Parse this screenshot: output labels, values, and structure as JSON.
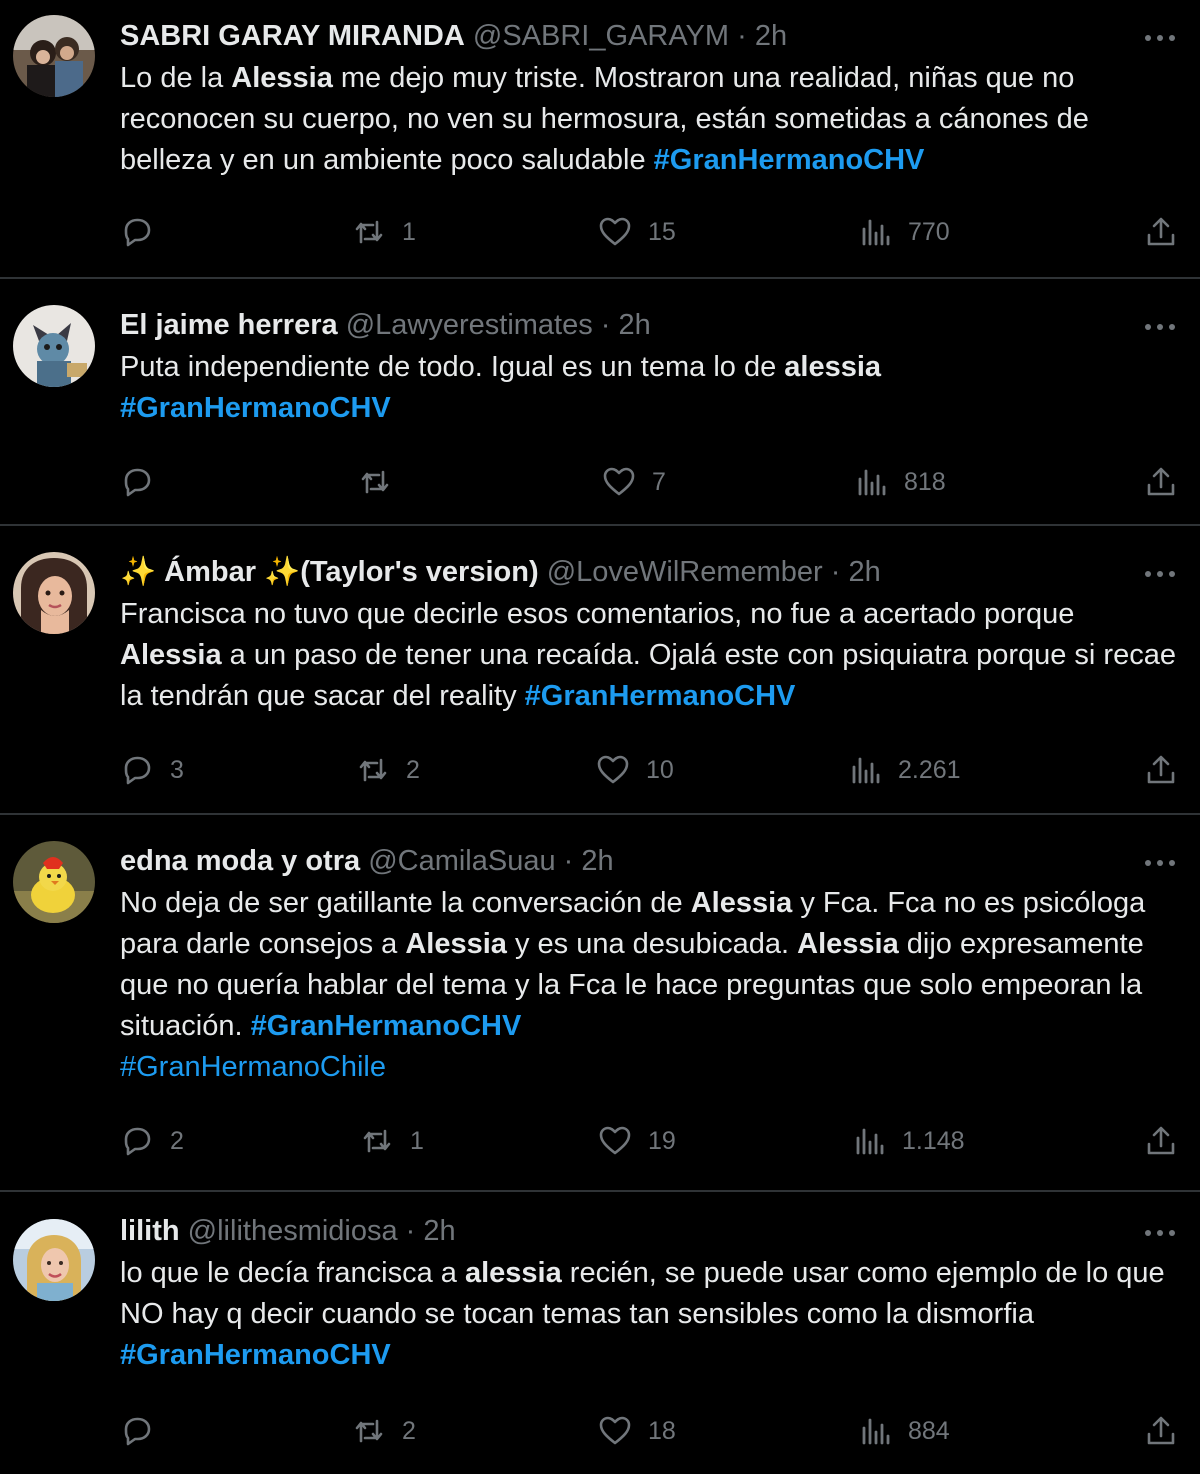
{
  "colors": {
    "background": "#000000",
    "text": "#e7e9ea",
    "muted": "#71767b",
    "link": "#1d9bf0",
    "divider": "#2f3336"
  },
  "icons": {
    "reply": "speech-bubble-icon",
    "retweet": "retweet-arrows-icon",
    "like": "heart-icon",
    "views": "bar-chart-icon",
    "share": "upload-arrow-icon",
    "more": "ellipsis-icon"
  },
  "tweets": [
    {
      "name": "SABRI GARAY MIRANDA",
      "handle": "@SABRI_GARAYM",
      "sep": " · ",
      "time": "2h",
      "segments": [
        {
          "t": "Lo de la "
        },
        {
          "t": "Alessia",
          "b": true
        },
        {
          "t": " me dejo muy triste. Mostraron una realidad, niñas que no reconocen su cuerpo, no ven su hermosura, están sometidas a cánones de belleza  y en un ambiente poco saludable "
        },
        {
          "t": "#GranHermanoCHV",
          "tag": true
        }
      ],
      "replies": "",
      "retweets": "1",
      "likes": "15",
      "views": "770"
    },
    {
      "name": "El jaime herrera",
      "handle": "@Lawyerestimates",
      "sep": " · ",
      "time": "2h",
      "segments": [
        {
          "t": "Puta independiente de todo. Igual es un tema lo de "
        },
        {
          "t": "alessia",
          "b": true
        },
        {
          "t": " "
        },
        {
          "t": "#GranHermanoCHV",
          "tag": true
        }
      ],
      "replies": "",
      "retweets": "",
      "likes": "7",
      "views": "818"
    },
    {
      "name": "✨ Ámbar ✨(Taylor's version)",
      "handle": "@LoveWilRemember",
      "sep": " · ",
      "time": "2h",
      "segments": [
        {
          "t": "Francisca no tuvo que decirle esos comentarios, no fue a acertado porque "
        },
        {
          "t": "Alessia",
          "b": true
        },
        {
          "t": " a un paso de tener una recaída. Ojalá este con psiquiatra porque si recae la tendrán que sacar del reality "
        },
        {
          "t": "#GranHermanoCHV",
          "tag": true
        }
      ],
      "replies": "3",
      "retweets": "2",
      "likes": "10",
      "views": "2.261"
    },
    {
      "name": "edna moda y otra",
      "handle": "@CamilaSuau",
      "sep": " · ",
      "time": "2h",
      "segments": [
        {
          "t": "No deja de ser gatillante la conversación de "
        },
        {
          "t": "Alessia",
          "b": true
        },
        {
          "t": " y Fca. Fca no es psicóloga para darle consejos a "
        },
        {
          "t": "Alessia",
          "b": true
        },
        {
          "t": " y es una desubicada. "
        },
        {
          "t": "Alessia",
          "b": true
        },
        {
          "t": " dijo expresamente que no quería hablar del tema y la Fca le hace preguntas que solo empeoran la situación. "
        },
        {
          "t": "#GranHermanoCHV",
          "tag": true
        },
        {
          "br": true
        },
        {
          "t": "#GranHermanoChile",
          "tag": true,
          "plain": true
        }
      ],
      "replies": "2",
      "retweets": "1",
      "likes": "19",
      "views": "1.148"
    },
    {
      "name": "lilith",
      "handle": "@lilithesmidiosa",
      "sep": " · ",
      "time": "2h",
      "segments": [
        {
          "t": "lo que le decía francisca a "
        },
        {
          "t": "alessia",
          "b": true
        },
        {
          "t": " recién, se puede usar como ejemplo de lo que NO hay q decir cuando se tocan temas tan sensibles como la dismorfia "
        },
        {
          "t": "#GranHermanoCHV",
          "tag": true
        }
      ],
      "replies": "",
      "retweets": "2",
      "likes": "18",
      "views": "884"
    }
  ]
}
